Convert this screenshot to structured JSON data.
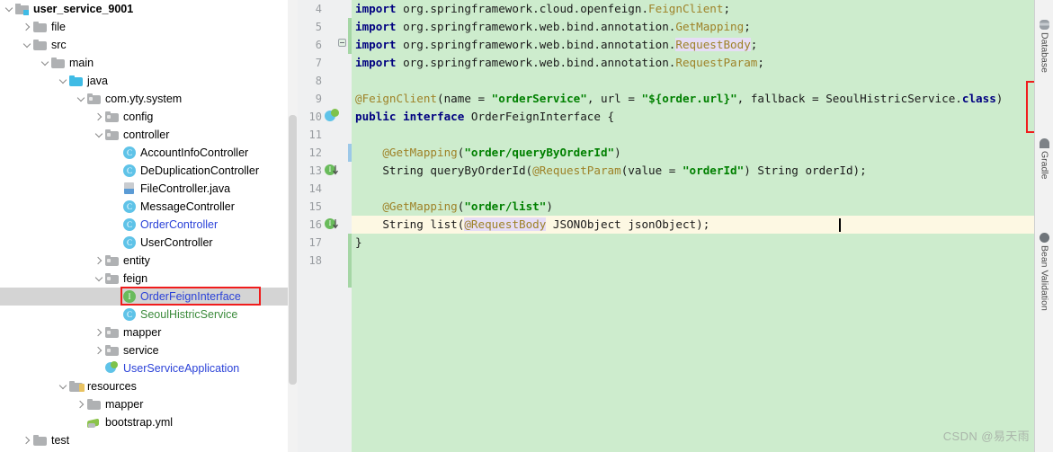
{
  "project_tree": {
    "scrollbar": {
      "visible": true
    },
    "items": [
      {
        "label": "user_service_9001",
        "indent": 0,
        "arrow": "expanded",
        "icon": "module-icon",
        "style": "bold"
      },
      {
        "label": "file",
        "indent": 1,
        "arrow": "collapsed",
        "icon": "folder-icon",
        "style": "normal"
      },
      {
        "label": "src",
        "indent": 1,
        "arrow": "expanded",
        "icon": "folder-icon",
        "style": "normal"
      },
      {
        "label": "main",
        "indent": 2,
        "arrow": "expanded",
        "icon": "folder-icon",
        "style": "normal"
      },
      {
        "label": "java",
        "indent": 3,
        "arrow": "expanded",
        "icon": "source-folder-icon",
        "style": "normal"
      },
      {
        "label": "com.yty.system",
        "indent": 4,
        "arrow": "expanded",
        "icon": "package-icon",
        "style": "normal"
      },
      {
        "label": "config",
        "indent": 5,
        "arrow": "collapsed",
        "icon": "package-icon",
        "style": "normal"
      },
      {
        "label": "controller",
        "indent": 5,
        "arrow": "expanded",
        "icon": "package-icon",
        "style": "normal"
      },
      {
        "label": "AccountInfoController",
        "indent": 6,
        "arrow": "none",
        "icon": "class-icon",
        "style": "normal"
      },
      {
        "label": "DeDuplicationController",
        "indent": 6,
        "arrow": "none",
        "icon": "class-icon",
        "style": "normal"
      },
      {
        "label": "FileController.java",
        "indent": 6,
        "arrow": "none",
        "icon": "java-file-icon",
        "style": "normal"
      },
      {
        "label": "MessageController",
        "indent": 6,
        "arrow": "none",
        "icon": "class-icon",
        "style": "normal"
      },
      {
        "label": "OrderController",
        "indent": 6,
        "arrow": "none",
        "icon": "class-icon",
        "style": "blue"
      },
      {
        "label": "UserController",
        "indent": 6,
        "arrow": "none",
        "icon": "class-icon",
        "style": "normal"
      },
      {
        "label": "entity",
        "indent": 5,
        "arrow": "collapsed",
        "icon": "package-icon",
        "style": "normal"
      },
      {
        "label": "feign",
        "indent": 5,
        "arrow": "expanded",
        "icon": "package-icon",
        "style": "normal"
      },
      {
        "label": "OrderFeignInterface",
        "indent": 6,
        "arrow": "none",
        "icon": "interface-icon",
        "style": "blue",
        "selected": true,
        "boxed": true
      },
      {
        "label": "SeoulHistricService",
        "indent": 6,
        "arrow": "none",
        "icon": "class-icon",
        "style": "green"
      },
      {
        "label": "mapper",
        "indent": 5,
        "arrow": "collapsed",
        "icon": "package-icon",
        "style": "normal"
      },
      {
        "label": "service",
        "indent": 5,
        "arrow": "collapsed",
        "icon": "package-icon",
        "style": "normal"
      },
      {
        "label": "UserServiceApplication",
        "indent": 5,
        "arrow": "none",
        "icon": "spring-boot-class-icon",
        "style": "blue"
      },
      {
        "label": "resources",
        "indent": 3,
        "arrow": "expanded",
        "icon": "resources-folder-icon",
        "style": "normal"
      },
      {
        "label": "mapper",
        "indent": 4,
        "arrow": "collapsed",
        "icon": "folder-icon",
        "style": "normal"
      },
      {
        "label": "bootstrap.yml",
        "indent": 4,
        "arrow": "none",
        "icon": "yaml-file-icon",
        "style": "normal"
      },
      {
        "label": "test",
        "indent": 1,
        "arrow": "collapsed",
        "icon": "folder-icon",
        "style": "normal"
      }
    ]
  },
  "editor": {
    "first_visible_line": 4,
    "caret_line": 16,
    "gutter_lines": [
      {
        "num": "4",
        "icon": "none"
      },
      {
        "num": "5",
        "icon": "none"
      },
      {
        "num": "6",
        "icon": "none"
      },
      {
        "num": "7",
        "icon": "none"
      },
      {
        "num": "8",
        "icon": "none"
      },
      {
        "num": "9",
        "icon": "none"
      },
      {
        "num": "10",
        "icon": "spring-bean-gutter-icon"
      },
      {
        "num": "11",
        "icon": "none"
      },
      {
        "num": "12",
        "icon": "none"
      },
      {
        "num": "13",
        "icon": "implemented-method-gutter-icon"
      },
      {
        "num": "14",
        "icon": "none"
      },
      {
        "num": "15",
        "icon": "none"
      },
      {
        "num": "16",
        "icon": "implemented-method-gutter-icon"
      },
      {
        "num": "17",
        "icon": "none"
      },
      {
        "num": "18",
        "icon": "none"
      }
    ],
    "lines": [
      {
        "num": 4,
        "tokens": [
          {
            "t": "import ",
            "c": "kw"
          },
          {
            "t": "org.springframework.cloud.openfeign.",
            "c": "plain"
          },
          {
            "t": "FeignClient",
            "c": "anno"
          },
          {
            "t": ";",
            "c": "plain"
          }
        ]
      },
      {
        "num": 5,
        "tokens": [
          {
            "t": "import ",
            "c": "kw"
          },
          {
            "t": "org.springframework.web.bind.annotation.",
            "c": "plain"
          },
          {
            "t": "GetMapping",
            "c": "anno"
          },
          {
            "t": ";",
            "c": "plain"
          }
        ]
      },
      {
        "num": 6,
        "tokens": [
          {
            "t": "import ",
            "c": "kw"
          },
          {
            "t": "org.springframework.web.bind.annotation.",
            "c": "plain"
          },
          {
            "t": "RequestBody",
            "c": "anno ident-hl"
          },
          {
            "t": ";",
            "c": "plain"
          }
        ]
      },
      {
        "num": 7,
        "tokens": [
          {
            "t": "import ",
            "c": "kw"
          },
          {
            "t": "org.springframework.web.bind.annotation.",
            "c": "plain"
          },
          {
            "t": "RequestParam",
            "c": "anno"
          },
          {
            "t": ";",
            "c": "plain"
          }
        ]
      },
      {
        "num": 8,
        "tokens": []
      },
      {
        "num": 9,
        "tokens": [
          {
            "t": "@FeignClient",
            "c": "anno"
          },
          {
            "t": "(name = ",
            "c": "plain"
          },
          {
            "t": "\"orderService\"",
            "c": "str"
          },
          {
            "t": ", url = ",
            "c": "plain"
          },
          {
            "t": "\"${order.url}\"",
            "c": "str"
          },
          {
            "t": ", fallback = SeoulHistricService.",
            "c": "plain"
          },
          {
            "t": "class",
            "c": "kw"
          },
          {
            "t": ")",
            "c": "plain"
          }
        ]
      },
      {
        "num": 10,
        "tokens": [
          {
            "t": "public interface ",
            "c": "kw"
          },
          {
            "t": "OrderFeignInterface {",
            "c": "plain"
          }
        ]
      },
      {
        "num": 11,
        "tokens": []
      },
      {
        "num": 12,
        "tokens": [
          {
            "t": "    @GetMapping",
            "c": "anno"
          },
          {
            "t": "(",
            "c": "plain"
          },
          {
            "t": "\"order/queryByOrderId\"",
            "c": "str"
          },
          {
            "t": ")",
            "c": "plain"
          }
        ]
      },
      {
        "num": 13,
        "tokens": [
          {
            "t": "    String queryByOrderId(",
            "c": "plain"
          },
          {
            "t": "@RequestParam",
            "c": "anno"
          },
          {
            "t": "(value = ",
            "c": "plain"
          },
          {
            "t": "\"orderId\"",
            "c": "str"
          },
          {
            "t": ") String orderId);",
            "c": "plain"
          }
        ]
      },
      {
        "num": 14,
        "tokens": []
      },
      {
        "num": 15,
        "tokens": [
          {
            "t": "    @GetMapping",
            "c": "anno"
          },
          {
            "t": "(",
            "c": "plain"
          },
          {
            "t": "\"order/list\"",
            "c": "str"
          },
          {
            "t": ")",
            "c": "plain"
          }
        ]
      },
      {
        "num": 16,
        "tokens": [
          {
            "t": "    String list(",
            "c": "plain"
          },
          {
            "t": "@RequestBody",
            "c": "anno ident-hl"
          },
          {
            "t": " JSONObject jsonObject);",
            "c": "plain"
          }
        ]
      },
      {
        "num": 17,
        "tokens": [
          {
            "t": "}",
            "c": "plain"
          }
        ]
      },
      {
        "num": 18,
        "tokens": []
      }
    ],
    "annotation_box": {
      "label": "fallback-annotation-highlight",
      "color": "#f01c1c"
    }
  },
  "right_toolbar": {
    "items": [
      {
        "label": "Database",
        "icon": "database-icon"
      },
      {
        "label": "Gradle",
        "icon": "gradle-icon"
      },
      {
        "label": "Bean Validation",
        "icon": "bean-validation-icon"
      }
    ]
  },
  "watermark": {
    "text": "CSDN @易天雨"
  },
  "colors": {
    "editor_vcs_added_bg": "#cdeccd",
    "caret_line_bg": "#fdf8e3",
    "annotation_red": "#f01c1c",
    "keyword": "#000080",
    "string": "#008000",
    "annotation_token": "#9e8228",
    "vcs_blue_file": "#2b42d8",
    "vcs_green_file": "#3a8a3a"
  }
}
